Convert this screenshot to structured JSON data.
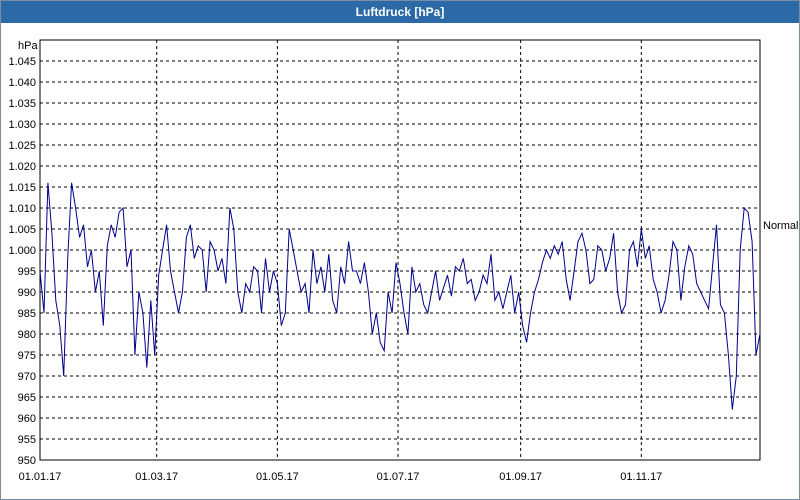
{
  "window": {
    "title": "Luftdruck [hPa]"
  },
  "chart_data": {
    "type": "line",
    "title": "Luftdruck [hPa]",
    "ylabel": "hPa",
    "xlabel": "",
    "ylim": [
      950,
      1050
    ],
    "yticks": [
      950,
      955,
      960,
      965,
      970,
      975,
      980,
      985,
      990,
      995,
      1000,
      1005,
      1010,
      1015,
      1020,
      1025,
      1030,
      1035,
      1040,
      1045
    ],
    "ytick_labels": [
      "950",
      "955",
      "960",
      "965",
      "970",
      "975",
      "980",
      "985",
      "990",
      "995",
      "1.000",
      "1.005",
      "1.010",
      "1.015",
      "1.020",
      "1.025",
      "1.030",
      "1.035",
      "1.040",
      "1.045"
    ],
    "xlim": [
      "2017-01-01",
      "2017-12-31"
    ],
    "xticks": [
      "2017-01-01",
      "2017-03-01",
      "2017-05-01",
      "2017-07-01",
      "2017-09-01",
      "2017-11-01"
    ],
    "xtick_labels": [
      "01.01.17",
      "01.03.17",
      "01.05.17",
      "01.07.17",
      "01.09.17",
      "01.11.17"
    ],
    "grid": true,
    "reference_line": {
      "label": "Normal",
      "value": 1006
    },
    "series": [
      {
        "color": "#00008b",
        "x": [
          "2017-01-01",
          "2017-01-03",
          "2017-01-05",
          "2017-01-07",
          "2017-01-09",
          "2017-01-11",
          "2017-01-13",
          "2017-01-15",
          "2017-01-17",
          "2017-01-19",
          "2017-01-21",
          "2017-01-23",
          "2017-01-25",
          "2017-01-27",
          "2017-01-29",
          "2017-01-31",
          "2017-02-02",
          "2017-02-04",
          "2017-02-06",
          "2017-02-08",
          "2017-02-10",
          "2017-02-12",
          "2017-02-14",
          "2017-02-16",
          "2017-02-18",
          "2017-02-20",
          "2017-02-22",
          "2017-02-24",
          "2017-02-26",
          "2017-02-28",
          "2017-03-02",
          "2017-03-04",
          "2017-03-06",
          "2017-03-08",
          "2017-03-10",
          "2017-03-12",
          "2017-03-14",
          "2017-03-16",
          "2017-03-18",
          "2017-03-20",
          "2017-03-22",
          "2017-03-24",
          "2017-03-26",
          "2017-03-28",
          "2017-03-30",
          "2017-04-01",
          "2017-04-03",
          "2017-04-05",
          "2017-04-07",
          "2017-04-09",
          "2017-04-11",
          "2017-04-13",
          "2017-04-15",
          "2017-04-17",
          "2017-04-19",
          "2017-04-21",
          "2017-04-23",
          "2017-04-25",
          "2017-04-27",
          "2017-04-29",
          "2017-05-01",
          "2017-05-03",
          "2017-05-05",
          "2017-05-07",
          "2017-05-09",
          "2017-05-11",
          "2017-05-13",
          "2017-05-15",
          "2017-05-17",
          "2017-05-19",
          "2017-05-21",
          "2017-05-23",
          "2017-05-25",
          "2017-05-27",
          "2017-05-29",
          "2017-05-31",
          "2017-06-02",
          "2017-06-04",
          "2017-06-06",
          "2017-06-08",
          "2017-06-10",
          "2017-06-12",
          "2017-06-14",
          "2017-06-16",
          "2017-06-18",
          "2017-06-20",
          "2017-06-22",
          "2017-06-24",
          "2017-06-26",
          "2017-06-28",
          "2017-06-30",
          "2017-07-02",
          "2017-07-04",
          "2017-07-06",
          "2017-07-08",
          "2017-07-10",
          "2017-07-12",
          "2017-07-14",
          "2017-07-16",
          "2017-07-18",
          "2017-07-20",
          "2017-07-22",
          "2017-07-24",
          "2017-07-26",
          "2017-07-28",
          "2017-07-30",
          "2017-08-01",
          "2017-08-03",
          "2017-08-05",
          "2017-08-07",
          "2017-08-09",
          "2017-08-11",
          "2017-08-13",
          "2017-08-15",
          "2017-08-17",
          "2017-08-19",
          "2017-08-21",
          "2017-08-23",
          "2017-08-25",
          "2017-08-27",
          "2017-08-29",
          "2017-08-31",
          "2017-09-02",
          "2017-09-04",
          "2017-09-06",
          "2017-09-08",
          "2017-09-10",
          "2017-09-12",
          "2017-09-14",
          "2017-09-16",
          "2017-09-18",
          "2017-09-20",
          "2017-09-22",
          "2017-09-24",
          "2017-09-26",
          "2017-09-28",
          "2017-09-30",
          "2017-10-02",
          "2017-10-04",
          "2017-10-06",
          "2017-10-08",
          "2017-10-10",
          "2017-10-12",
          "2017-10-14",
          "2017-10-16",
          "2017-10-18",
          "2017-10-20",
          "2017-10-22",
          "2017-10-24",
          "2017-10-26",
          "2017-10-28",
          "2017-10-30",
          "2017-11-01",
          "2017-11-03",
          "2017-11-05",
          "2017-11-07",
          "2017-11-09",
          "2017-11-11",
          "2017-11-13",
          "2017-11-15",
          "2017-11-17",
          "2017-11-19",
          "2017-11-21",
          "2017-11-23",
          "2017-11-25",
          "2017-11-27",
          "2017-11-29",
          "2017-12-01",
          "2017-12-03",
          "2017-12-05",
          "2017-12-07",
          "2017-12-09",
          "2017-12-11",
          "2017-12-13",
          "2017-12-15",
          "2017-12-17",
          "2017-12-19",
          "2017-12-21",
          "2017-12-23",
          "2017-12-25",
          "2017-12-27",
          "2017-12-29",
          "2017-12-31"
        ],
        "y": [
          995,
          985,
          1016,
          1004,
          988,
          982,
          970,
          998,
          1016,
          1010,
          1003,
          1006,
          996,
          1000,
          990,
          995,
          982,
          1001,
          1006,
          1003,
          1009,
          1010,
          996,
          1000,
          975,
          990,
          985,
          972,
          988,
          975,
          994,
          1000,
          1006,
          995,
          990,
          985,
          990,
          1003,
          1006,
          998,
          1001,
          1000,
          990,
          1002,
          1000,
          995,
          998,
          992,
          1010,
          1005,
          990,
          985,
          992,
          990,
          996,
          995,
          985,
          998,
          990,
          995,
          992,
          982,
          985,
          1005,
          1000,
          995,
          990,
          992,
          985,
          1000,
          992,
          996,
          990,
          999,
          988,
          985,
          996,
          992,
          1002,
          995,
          995,
          992,
          997,
          990,
          980,
          985,
          978,
          976,
          990,
          985,
          997,
          992,
          985,
          980,
          996,
          990,
          992,
          987,
          985,
          990,
          995,
          988,
          991,
          994,
          989,
          996,
          995,
          998,
          992,
          993,
          988,
          990,
          994,
          992,
          999,
          988,
          990,
          986,
          990,
          994,
          985,
          990,
          982,
          978,
          985,
          990,
          993,
          997,
          1000,
          998,
          1001,
          999,
          1002,
          993,
          988,
          995,
          1002,
          1004,
          1000,
          992,
          993,
          1001,
          1000,
          995,
          998,
          1004,
          990,
          985,
          987,
          1000,
          1002,
          996,
          1005,
          998,
          1001,
          993,
          990,
          985,
          988,
          994,
          1002,
          1000,
          988,
          996,
          1001,
          999,
          992,
          990,
          988,
          986,
          996,
          1006,
          987,
          985,
          975,
          962,
          970,
          1000,
          1010,
          1009,
          1002,
          975,
          980
        ]
      }
    ]
  }
}
